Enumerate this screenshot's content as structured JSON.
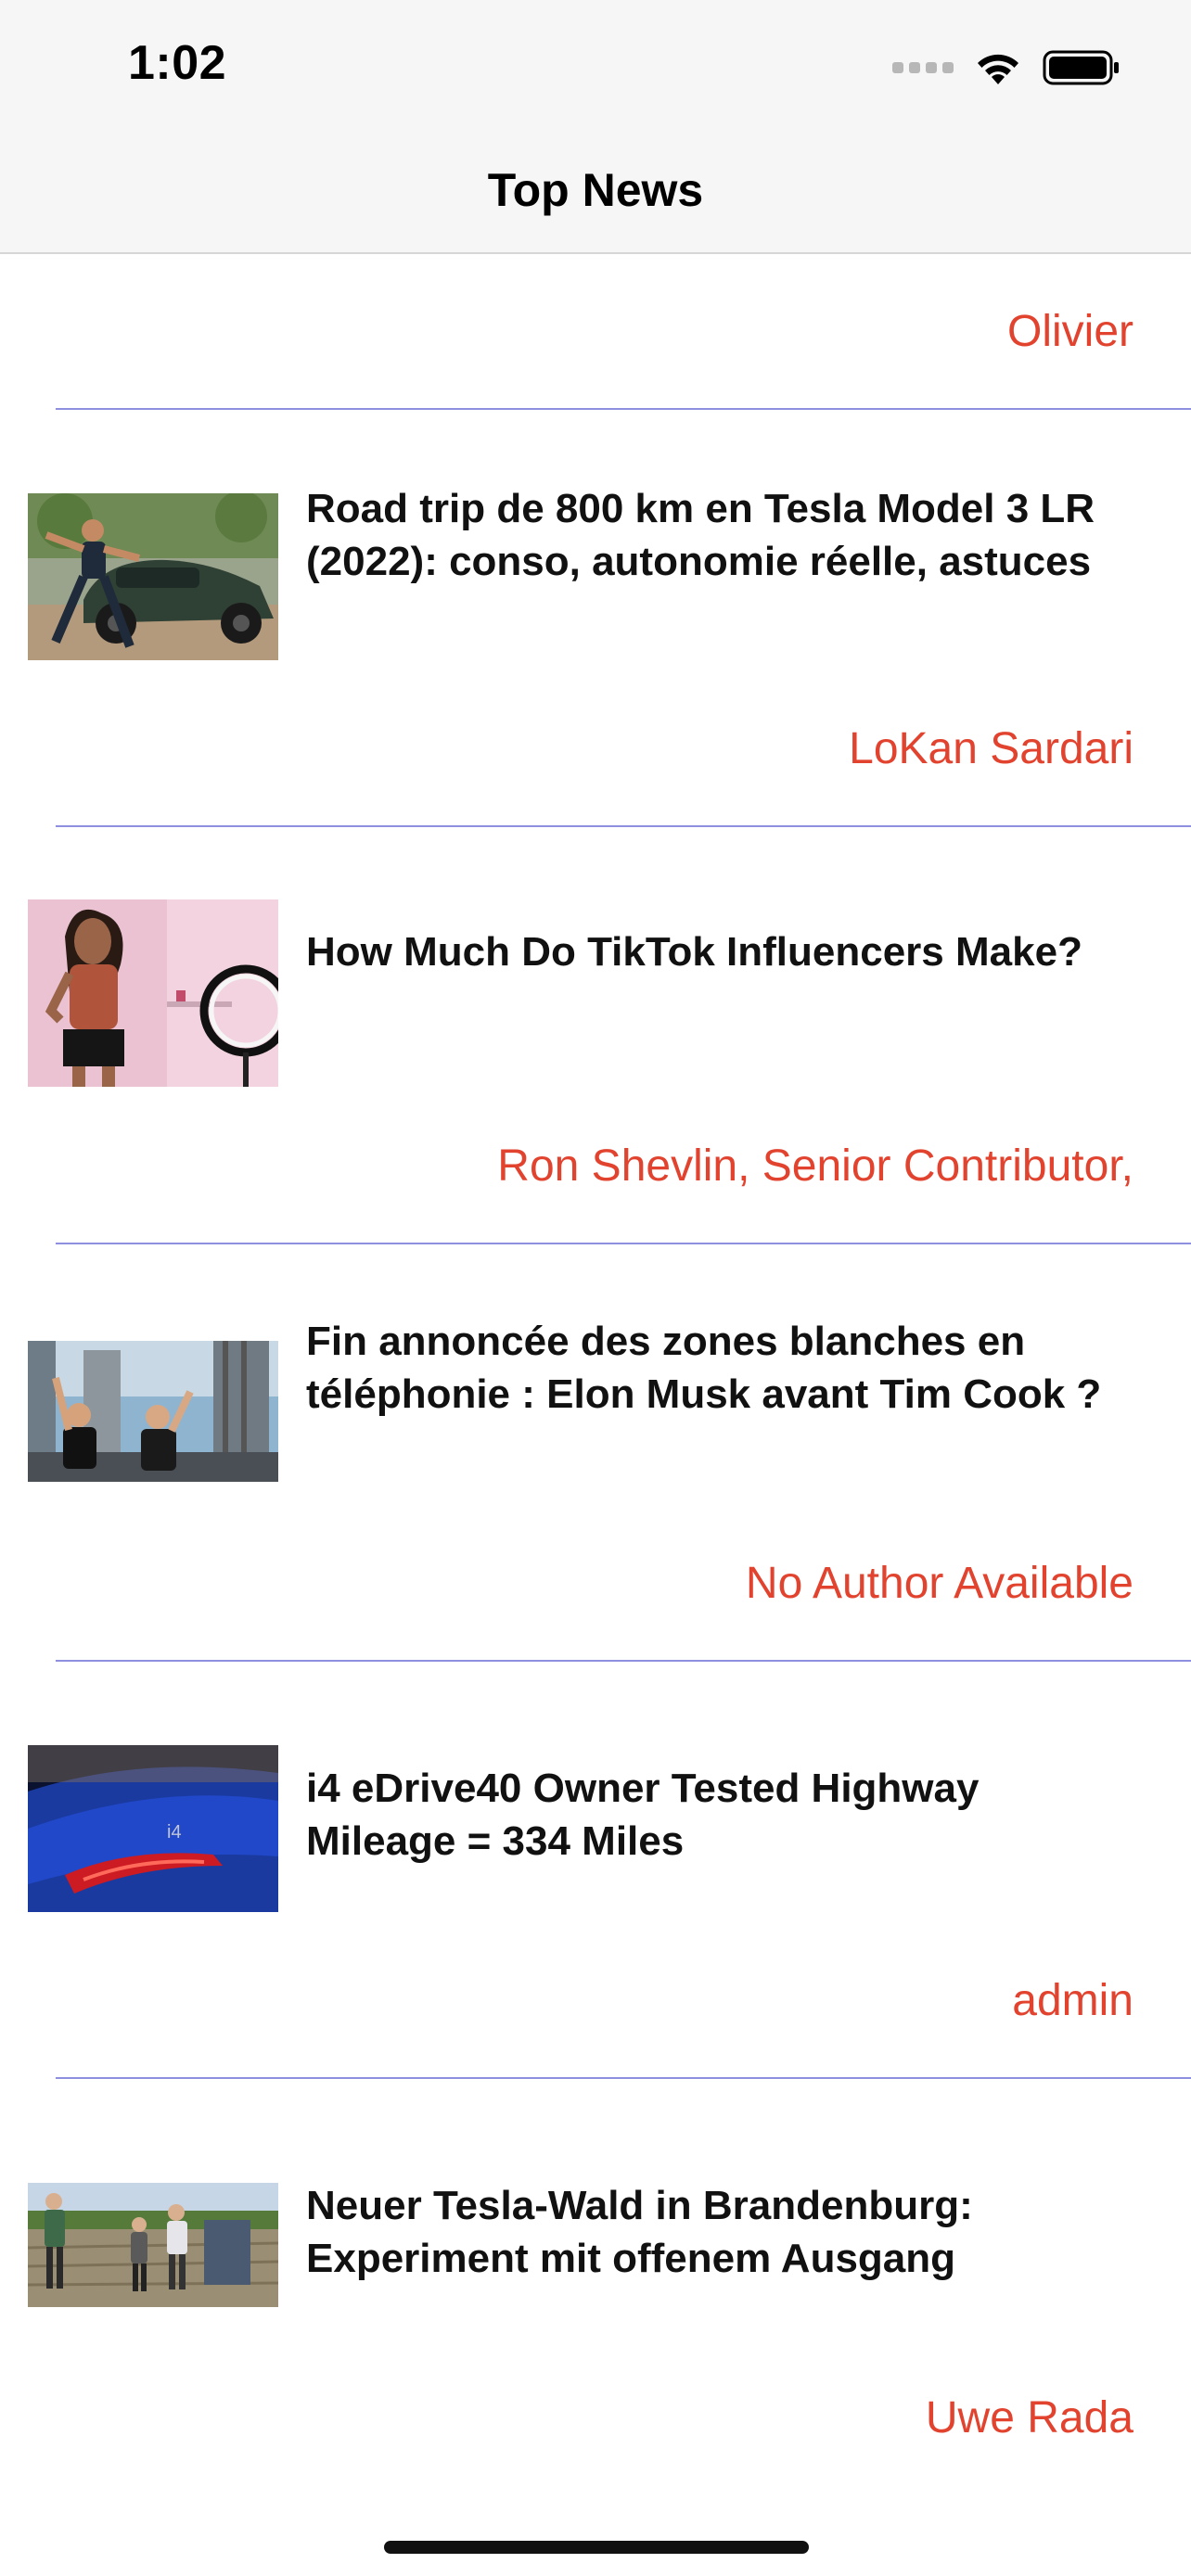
{
  "status_bar": {
    "time": "1:02",
    "icons": [
      "cellular-signal-icon",
      "wifi-icon",
      "battery-icon"
    ]
  },
  "nav": {
    "title": "Top News"
  },
  "colors": {
    "author_text": "#e2432f",
    "separator": "#8f8fe0",
    "headline_text": "#111111",
    "nav_background": "#f6f6f6"
  },
  "top_author": "Olivier",
  "articles": [
    {
      "title": " Road trip de 800 km en Tesla Model 3 LR (2022): conso, autonomie réelle, astuces",
      "author": "LoKan Sardari",
      "image": "green-tesla-photo"
    },
    {
      "title": " How Much Do TikTok Influencers Make?",
      "author": "Ron Shevlin, Senior Contributor,",
      "image": "influencer-ring-light-photo"
    },
    {
      "title": " Fin annoncée des zones blanches en téléphonie : Elon Musk avant Tim Cook ?",
      "author": "No Author Available",
      "image": "rocket-launch-celebration-photo"
    },
    {
      "title": " i4 eDrive40 Owner Tested Highway Mileage = 334 Miles",
      "author": "admin",
      "image": "blue-bmw-taillight-photo"
    },
    {
      "title": " Neuer Tesla-Wald in Brandenburg: Experiment mit offenem Ausgang",
      "author": "Uwe Rada",
      "image": "people-in-field-photo"
    }
  ]
}
